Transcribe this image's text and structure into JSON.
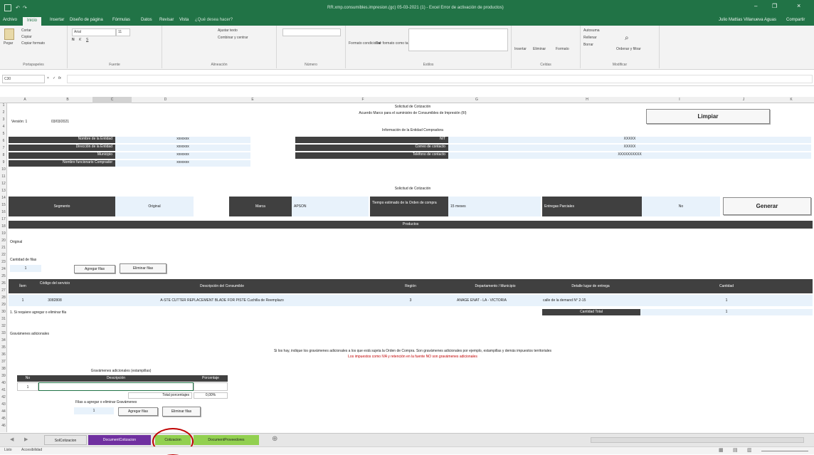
{
  "titlebar": {
    "title": "RR.xmp.consumibles.impresion.(gc) 05-03-2021 (1) - Excel Error de activación de productos)",
    "user": "Julio Mattias Villanueva Aguas",
    "share": "Compartir"
  },
  "tabs": [
    "Archivo",
    "Inicio",
    "Insertar",
    "Diseño de página",
    "Fórmulas",
    "Datos",
    "Revisar",
    "Vista",
    "¿Qué desea hacer?"
  ],
  "ribbon": {
    "clipboard": {
      "paste": "Pegar",
      "cut": "Cortar",
      "copy": "Copiar",
      "format": "Copiar formato",
      "label": "Portapapeles"
    },
    "font": {
      "name": "Arial",
      "size": "11",
      "label": "Fuente"
    },
    "align": {
      "wrap": "Ajustar texto",
      "merge": "Combinar y centrar",
      "label": "Alineación"
    },
    "number": {
      "label": "Número"
    },
    "styles": {
      "cond": "Formato condicional",
      "table": "Dar formato como tabla",
      "label": "Estilos"
    },
    "cells": {
      "insert": "Insertar",
      "delete": "Eliminar",
      "format": "Formato",
      "label": "Celdas"
    },
    "editing": {
      "autosum": "Autosuma",
      "fill": "Rellenar",
      "clear": "Borrar",
      "sort": "Ordenar y filtrar",
      "find": "Buscar y seleccionar",
      "label": "Modificar"
    }
  },
  "formula_bar": {
    "namebox": "C30",
    "fx": "fx"
  },
  "columns": [
    "A",
    "B",
    "C",
    "D",
    "E",
    "F",
    "G",
    "H",
    "I",
    "J",
    "K"
  ],
  "sheet": {
    "title1": "Solicitud de Cotización",
    "title2": "Acuerdo Marco para el suministro de Consumibles de Impresión (III)",
    "version_label": "Versión: 1",
    "version_date": "03/03/2021",
    "clear_button": "Limpiar",
    "entity_header": "Información de la Entidad Compradora",
    "entity_fields": [
      {
        "label": "Nombre de la Entidad",
        "value": "xxxxxxx"
      },
      {
        "label": "Dirección de la Entidad",
        "value": "xxxxxxx"
      },
      {
        "label": "Municipio",
        "value": "xxxxxxx"
      },
      {
        "label": "Nombre funcionario Comprador",
        "value": "xxxxxxx"
      }
    ],
    "contact_fields": [
      {
        "label": "NIT",
        "value": "XXXXX"
      },
      {
        "label": "Correo de contacto",
        "value": "XXXXX"
      },
      {
        "label": "Teléfono de contacto",
        "value": "XXXXXXXXXX"
      }
    ],
    "quote_header": "Solicitud de Cotización",
    "quote_row": {
      "segment_label": "Segmento",
      "segment_value": "Original",
      "brand_label": "Marca",
      "brand_value": "APSON",
      "time_label": "Tiempo estimado de la Orden de compra",
      "time_value": "15 meses",
      "partial_label": "Entregas Parciales",
      "partial_value": "No"
    },
    "generate_button": "Generar",
    "products_header": "Productos",
    "products_sub": "Original",
    "rows_label": "Cantidad de filas",
    "rows_value": "1",
    "add_rows": "Agregar filas",
    "delete_rows": "Eliminar filas",
    "table_headers": [
      "Ítem",
      "Código del servicio",
      "Descripción del Consumible",
      "Región",
      "Departamento / Municipio",
      "Detalle lugar de entrega",
      "Cantidad"
    ],
    "table_rows": [
      {
        "item": "1",
        "code": "3082808",
        "desc": "A-STE CUTTER REPLACEMENT BLADE FOR PISTE Cuchilla de Reemplazo",
        "region": "3",
        "dept": "ANAGE ENAT - LA - VICTORIA",
        "place": "calle de la demand N° 2-15",
        "qty": "1"
      }
    ],
    "total_label": "Cantidad Total",
    "total_value": "1",
    "note": "1. Si requiere agregar o eliminar fila",
    "additional_label": "Gravámenes adicionales",
    "additional_note": "Si los hay, indique los gravámenes adicionales a los que está sujeta la Orden de Compra. Son gravámenes adicionales por ejemplo, estampillas y demás impuestos territoriales",
    "additional_note_red": "Los impuestos como IVA y retención en la fuente NO son gravámenes adicionales",
    "grav_title": "Gravámenes adicionales (estampillas)",
    "grav_headers": [
      "No",
      "Descripción",
      "Porcentaje"
    ],
    "grav_row": {
      "no": "1",
      "desc": "",
      "pct": ""
    },
    "grav_total_label": "Total porcentajes",
    "grav_total_value": "0,00%",
    "grav_rows_label": "Filas a agregar o eliminar Gravámenes",
    "grav_rows_value": "1",
    "grav_add": "Agregar filas",
    "grav_delete": "Eliminar filas"
  },
  "sheet_tabs": [
    {
      "label": "SolCotizacion",
      "color": "#ffffff",
      "text": "#1f1f1f"
    },
    {
      "label": "DocumentCotizacion",
      "color": "#7030a0",
      "text": "#ffffff"
    },
    {
      "label": "Cotizacion",
      "color": "#92d050",
      "text": "#1f1f1f"
    },
    {
      "label": "DocumentProveedores",
      "color": "#92d050",
      "text": "#1f1f1f"
    }
  ],
  "status": {
    "ready": "Listo",
    "access": "Accesibilidad"
  },
  "colors": {
    "excel_green": "#217346",
    "dark_header": "#404040",
    "light_blue": "#e8f2fb",
    "highlight_circle": "#c00000"
  }
}
